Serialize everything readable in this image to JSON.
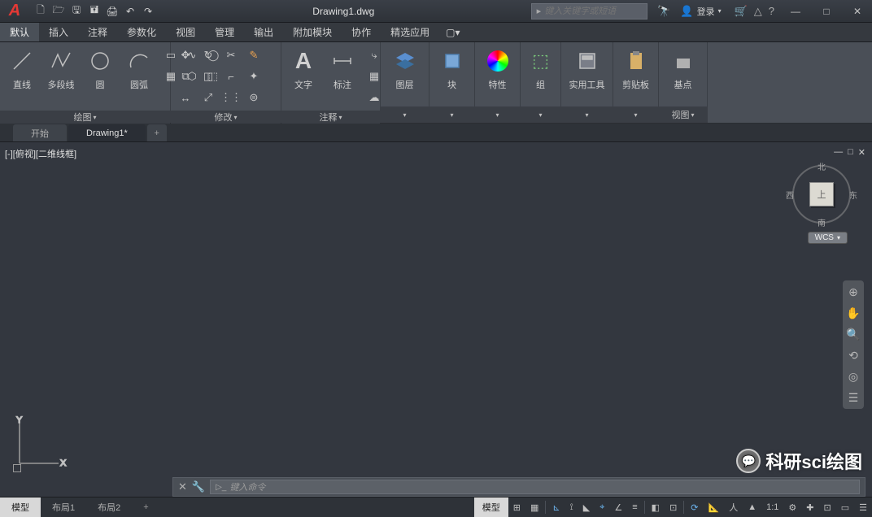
{
  "title": "Drawing1.dwg",
  "search": {
    "placeholder": "键入关键字或短语"
  },
  "login": {
    "label": "登录"
  },
  "menubar": {
    "items": [
      "默认",
      "插入",
      "注释",
      "参数化",
      "视图",
      "管理",
      "输出",
      "附加模块",
      "协作",
      "精选应用"
    ],
    "active": 0
  },
  "ribbon": {
    "panels": {
      "draw": {
        "title": "绘图",
        "tools": [
          "直线",
          "多段线",
          "圆",
          "圆弧"
        ]
      },
      "modify": {
        "title": "修改"
      },
      "annot": {
        "title": "注释",
        "tools": [
          "文字",
          "标注"
        ]
      },
      "layers": {
        "title": "图层"
      },
      "block": {
        "title": "块"
      },
      "props": {
        "title": "特性"
      },
      "group": {
        "title": "组"
      },
      "utils": {
        "title": "实用工具"
      },
      "clip": {
        "title": "剪贴板"
      },
      "base": {
        "title": "基点",
        "panel_title": "视图"
      }
    }
  },
  "filetabs": {
    "items": [
      "开始",
      "Drawing1*"
    ],
    "active": 1
  },
  "viewport": {
    "label": "[-][俯视][二维线框]"
  },
  "viewcube": {
    "n": "北",
    "s": "南",
    "e": "东",
    "w": "西",
    "top": "上"
  },
  "wcs": "WCS",
  "ucs": {
    "x": "X",
    "y": "Y"
  },
  "cmd": {
    "placeholder": "键入命令"
  },
  "status": {
    "tabs": [
      "模型",
      "布局1",
      "布局2"
    ],
    "active": 0,
    "model_btn": "模型",
    "scale": "1:1"
  },
  "watermark": "科研sci绘图"
}
